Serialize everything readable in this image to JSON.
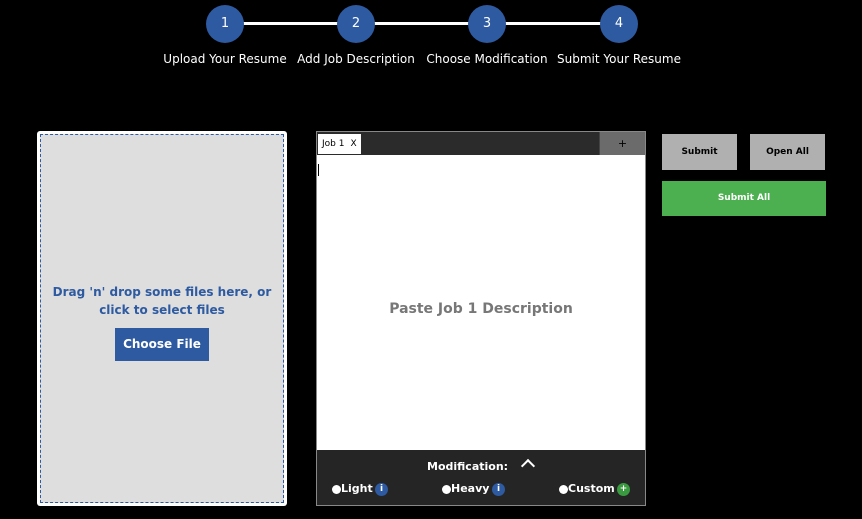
{
  "stepper": {
    "steps": [
      {
        "number": "1",
        "label": "Upload Your Resume"
      },
      {
        "number": "2",
        "label": "Add Job Description"
      },
      {
        "number": "3",
        "label": "Choose Modification"
      },
      {
        "number": "4",
        "label": "Submit Your Resume"
      }
    ]
  },
  "dropzone": {
    "text": "Drag 'n' drop some files here, or click to select files",
    "choose_file_label": "Choose File"
  },
  "job_panel": {
    "tabs": [
      {
        "label": "Job 1",
        "close_label": "X"
      }
    ],
    "add_tab_label": "+",
    "placeholder": "Paste Job 1 Description"
  },
  "modification": {
    "title": "Modification:",
    "options": [
      {
        "label": "Light",
        "icon": "info-icon",
        "icon_glyph": "i"
      },
      {
        "label": "Heavy",
        "icon": "info-icon",
        "icon_glyph": "i"
      },
      {
        "label": "Custom",
        "icon": "plus-icon",
        "icon_glyph": "+"
      }
    ]
  },
  "actions": {
    "submit_label": "Submit",
    "open_all_label": "Open All",
    "submit_all_label": "Submit All"
  },
  "colors": {
    "accent_blue": "#2d5aa0",
    "success_green": "#4caf50"
  }
}
